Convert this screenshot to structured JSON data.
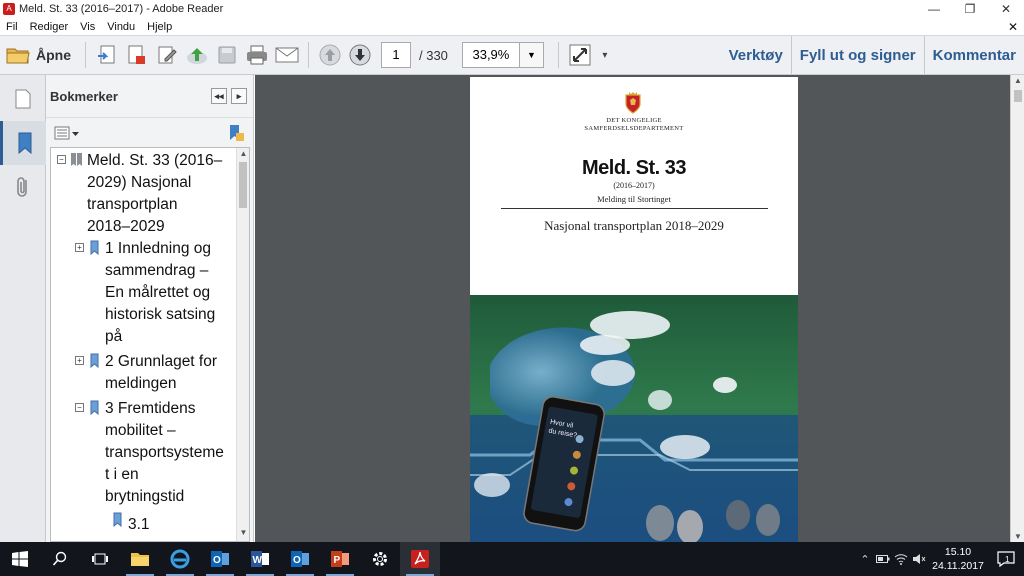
{
  "window": {
    "title": "Meld. St. 33 (2016–2017) - Adobe Reader",
    "app_icon": "acrobat-icon"
  },
  "menu": [
    "Fil",
    "Rediger",
    "Vis",
    "Vindu",
    "Hjelp"
  ],
  "toolbar": {
    "open_label": "Åpne",
    "current_page": "1",
    "page_count": "/ 330",
    "zoom": "33,9%",
    "links": [
      "Verktøy",
      "Fyll ut og signer",
      "Kommentar"
    ]
  },
  "sidebar": {
    "title": "Bokmerker",
    "bookmarks": [
      {
        "label_lines": [
          "Meld. St. 33 (2016–",
          "2029) Nasjonal",
          "transportplan",
          "2018–2029"
        ],
        "expander": "−"
      },
      {
        "label_lines": [
          "1 Innledning og",
          "sammendrag –",
          "En målrettet og",
          "historisk satsing",
          "på"
        ],
        "expander": "+"
      },
      {
        "label_lines": [
          "2 Grunnlaget for",
          "meldingen"
        ],
        "expander": "+"
      },
      {
        "label_lines": [
          "3 Fremtidens",
          "mobilitet –",
          "transportsysteme",
          "t i en",
          "brytningstid"
        ],
        "expander": "−"
      },
      {
        "label_lines": [
          "3.1"
        ],
        "expander": ""
      }
    ]
  },
  "document": {
    "department_lines": [
      "DET KONGELIGE",
      "SAMFERDSELSDEPARTEMENT"
    ],
    "title": "Meld. St. 33",
    "year": "(2016–2017)",
    "subtitle": "Melding til Stortinget",
    "name": "Nasjonal transportplan 2018–2029",
    "phone_text": [
      "Hvor vil",
      "du reise?"
    ]
  },
  "taskbar": {
    "apps": [
      "windows-start-icon",
      "search-icon",
      "task-view-icon",
      "file-explorer-icon",
      "edge-icon",
      "outlook-icon",
      "word-icon",
      "outlook-icon",
      "powerpoint-icon",
      "settings-icon",
      "acrobat-icon"
    ],
    "time": "15.10",
    "date": "24.11.2017",
    "notification_count": "1"
  },
  "colors": {
    "accent_link": "#2d5d92",
    "doc_background": "#525659",
    "taskbar": "#12161c"
  }
}
